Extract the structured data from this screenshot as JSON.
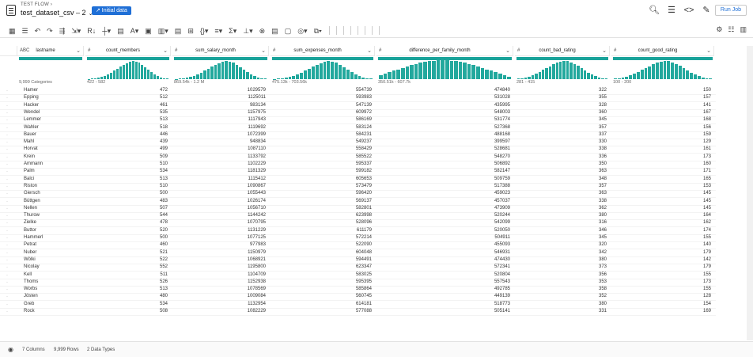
{
  "header": {
    "flow": "TEST FLOW ›",
    "dataset": "test_dataset_csv – 2",
    "chevron": "⌄",
    "initial": "↗ Initial data",
    "run_job": "Run Job"
  },
  "top_icons": [
    {
      "name": "search-icon",
      "glyph": "🔍︎"
    },
    {
      "name": "list-icon",
      "glyph": "☰"
    },
    {
      "name": "code-icon",
      "glyph": "<>"
    },
    {
      "name": "eyedropper-icon",
      "glyph": "✎"
    }
  ],
  "toolbar": [
    {
      "name": "grid-view-icon",
      "g": "▦"
    },
    {
      "name": "list-view-icon",
      "g": "☰"
    },
    {
      "sep": true
    },
    {
      "name": "undo-icon",
      "g": "↶"
    },
    {
      "name": "redo-icon",
      "g": "↷"
    },
    {
      "sep": true
    },
    {
      "name": "restructure-icon",
      "g": "⇶"
    },
    {
      "name": "transform-icon",
      "g": "⇲▾"
    },
    {
      "name": "row-number-icon",
      "g": "R↓"
    },
    {
      "sep": true
    },
    {
      "name": "column-icon",
      "g": "┼▾"
    },
    {
      "name": "split-icon",
      "g": "▤"
    },
    {
      "name": "text-format-icon",
      "g": "A▾"
    },
    {
      "name": "clean-icon",
      "g": "▣"
    },
    {
      "sep": true
    },
    {
      "name": "filter-rows-icon",
      "g": "▥▾"
    },
    {
      "name": "nest-icon",
      "g": "▤"
    },
    {
      "name": "merge-icon",
      "g": "⊞"
    },
    {
      "name": "extract-icon",
      "g": "{}▾"
    },
    {
      "sep": true
    },
    {
      "name": "sort-icon",
      "g": "≡▾"
    },
    {
      "sep": true
    },
    {
      "name": "sum-icon",
      "g": "Σ▾"
    },
    {
      "name": "hierarchy-icon",
      "g": "⊥▾"
    },
    {
      "sep": true
    },
    {
      "name": "join-icon",
      "g": "⊗"
    },
    {
      "name": "union-icon",
      "g": "▤"
    },
    {
      "name": "comment-icon",
      "g": "▢"
    },
    {
      "name": "macro-icon",
      "g": "◎▾"
    },
    {
      "sep": true
    },
    {
      "name": "more-icon",
      "g": "⧉▾"
    }
  ],
  "toolbar_right": [
    {
      "name": "settings-icon",
      "g": "⚙"
    },
    {
      "name": "columns-icon",
      "g": "☷"
    },
    {
      "name": "wrap-icon",
      "g": "▥"
    }
  ],
  "columns": [
    {
      "type": "ABC",
      "name": "lastname",
      "range": "9,999 Categories"
    },
    {
      "type": "#",
      "name": "count_members",
      "range": "422 - 582"
    },
    {
      "type": "#",
      "name": "sum_salary_month",
      "range": "869.54k - 1.2 M"
    },
    {
      "type": "#",
      "name": "sum_expenses_month",
      "range": "475.13k - 703.56k"
    },
    {
      "type": "#",
      "name": "difference_per_family_month",
      "range": "350.51k - 607.7k"
    },
    {
      "type": "#",
      "name": "count_bad_rating",
      "range": "281 - 415"
    },
    {
      "type": "#",
      "name": "count_good_rating",
      "range": "100 - 200"
    }
  ],
  "rows": [
    [
      "Hamer",
      "472",
      "1029579",
      "554739",
      "474840",
      "322",
      "150"
    ],
    [
      "Epping",
      "512",
      "1125011",
      "593983",
      "531028",
      "355",
      "157"
    ],
    [
      "Hacker",
      "461",
      "983134",
      "547139",
      "435995",
      "328",
      "141"
    ],
    [
      "Wendel",
      "535",
      "1157975",
      "609972",
      "548003",
      "360",
      "167"
    ],
    [
      "Lemmer",
      "513",
      "1117943",
      "586169",
      "531774",
      "345",
      "168"
    ],
    [
      "Wahler",
      "518",
      "1119692",
      "583124",
      "527368",
      "357",
      "156"
    ],
    [
      "Bauer",
      "446",
      "1072399",
      "584231",
      "488168",
      "337",
      "159"
    ],
    [
      "Mahl",
      "439",
      "948834",
      "549237",
      "399597",
      "330",
      "129"
    ],
    [
      "Horvat",
      "499",
      "1087110",
      "558429",
      "528681",
      "338",
      "161"
    ],
    [
      "Krein",
      "509",
      "1133792",
      "585522",
      "548270",
      "336",
      "173"
    ],
    [
      "Ammann",
      "510",
      "1102229",
      "595337",
      "506892",
      "350",
      "160"
    ],
    [
      "Palm",
      "534",
      "1181329",
      "599182",
      "582147",
      "363",
      "171"
    ],
    [
      "Balci",
      "513",
      "1115412",
      "605653",
      "509759",
      "348",
      "165"
    ],
    [
      "Riston",
      "510",
      "1090867",
      "573479",
      "517388",
      "357",
      "153"
    ],
    [
      "Giersch",
      "500",
      "1055443",
      "596420",
      "459023",
      "363",
      "145"
    ],
    [
      "Büttgen",
      "483",
      "1026174",
      "569137",
      "457037",
      "338",
      "145"
    ],
    [
      "Nellen",
      "507",
      "1056710",
      "582801",
      "473909",
      "362",
      "145"
    ],
    [
      "Thurow",
      "544",
      "1144242",
      "623998",
      "520244",
      "380",
      "164"
    ],
    [
      "Zielke",
      "478",
      "1070795",
      "528096",
      "542099",
      "316",
      "162"
    ],
    [
      "Buttor",
      "520",
      "1131229",
      "611179",
      "520050",
      "346",
      "174"
    ],
    [
      "Hammerl",
      "500",
      "1077125",
      "572214",
      "504911",
      "345",
      "155"
    ],
    [
      "Petrat",
      "460",
      "977983",
      "522090",
      "455093",
      "320",
      "140"
    ],
    [
      "Nuber",
      "521",
      "1150979",
      "604048",
      "546931",
      "342",
      "179"
    ],
    [
      "Wölki",
      "522",
      "1068921",
      "594491",
      "474430",
      "380",
      "142"
    ],
    [
      "Nicolay",
      "552",
      "1195800",
      "623347",
      "572341",
      "373",
      "179"
    ],
    [
      "Kell",
      "511",
      "1104709",
      "583025",
      "520804",
      "356",
      "155"
    ],
    [
      "Thoms",
      "526",
      "1152938",
      "595395",
      "557543",
      "353",
      "173"
    ],
    [
      "Worbs",
      "513",
      "1078569",
      "585864",
      "492785",
      "358",
      "155"
    ],
    [
      "Jösten",
      "480",
      "1009084",
      "560745",
      "449139",
      "352",
      "128"
    ],
    [
      "Greb",
      "534",
      "1132954",
      "614181",
      "518773",
      "380",
      "154"
    ],
    [
      "Rock",
      "508",
      "1082229",
      "577088",
      "505141",
      "331",
      "169"
    ]
  ],
  "footer": {
    "columns": "7 Columns",
    "rows": "9,999 Rows",
    "types": "2 Data Types"
  },
  "hist": [
    [],
    [
      2,
      3,
      5,
      8,
      12,
      18,
      26,
      34,
      44,
      55,
      66,
      76,
      84,
      90,
      94,
      92,
      86,
      76,
      64,
      50,
      38,
      26,
      16,
      9,
      5,
      3
    ],
    [
      2,
      3,
      5,
      8,
      12,
      18,
      26,
      34,
      44,
      55,
      66,
      76,
      84,
      90,
      94,
      92,
      86,
      76,
      64,
      50,
      38,
      26,
      16,
      9,
      5,
      3
    ],
    [
      2,
      3,
      5,
      8,
      12,
      18,
      26,
      34,
      44,
      55,
      66,
      76,
      84,
      90,
      94,
      92,
      86,
      76,
      64,
      50,
      38,
      26,
      16,
      9,
      5,
      3
    ],
    [
      20,
      28,
      36,
      44,
      52,
      60,
      68,
      74,
      80,
      86,
      90,
      94,
      96,
      98,
      100,
      98,
      96,
      94,
      90,
      86,
      80,
      74,
      68,
      60,
      52,
      44,
      36,
      28,
      20,
      14
    ],
    [
      3,
      5,
      8,
      13,
      20,
      28,
      38,
      48,
      58,
      68,
      78,
      86,
      92,
      96,
      94,
      88,
      80,
      70,
      58,
      46,
      34,
      24,
      15,
      9,
      5,
      3
    ],
    [
      3,
      5,
      8,
      13,
      20,
      28,
      38,
      48,
      58,
      68,
      78,
      86,
      92,
      96,
      94,
      88,
      80,
      70,
      58,
      46,
      34,
      24,
      15,
      9,
      5,
      3
    ]
  ]
}
